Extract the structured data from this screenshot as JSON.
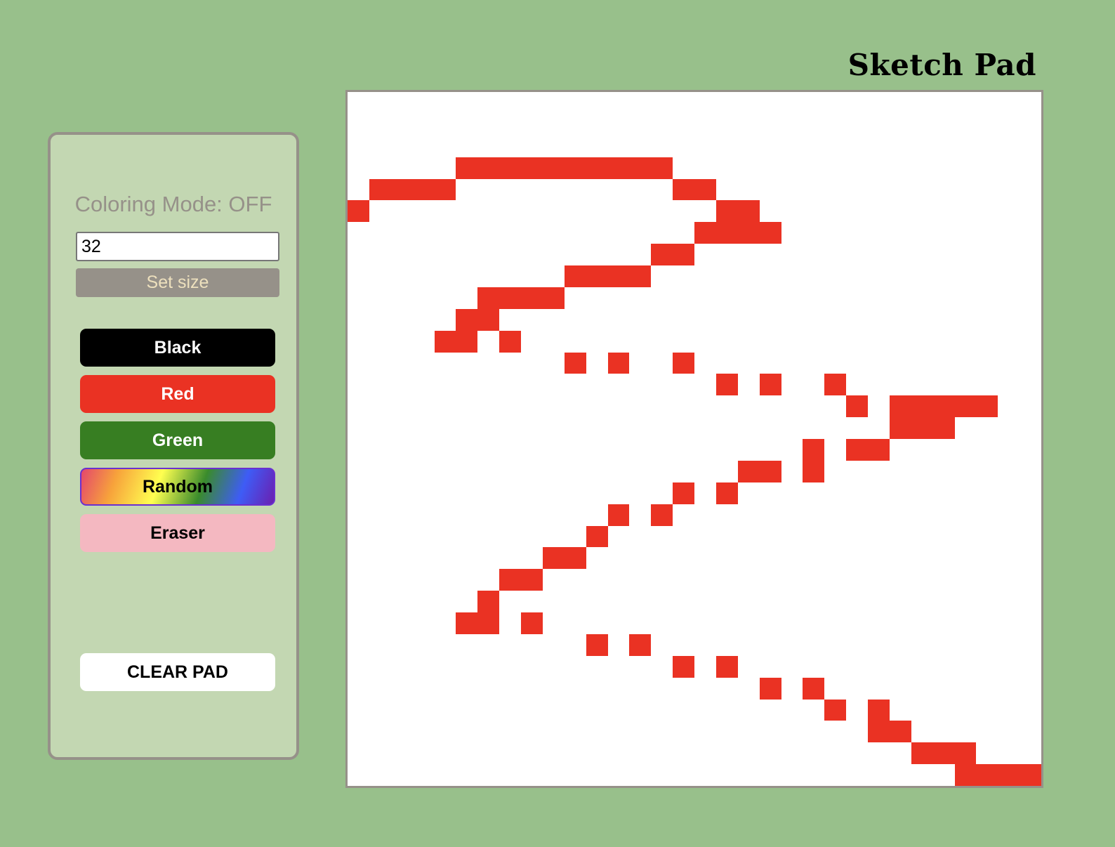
{
  "header": {
    "title": "Sketch Pad"
  },
  "controls": {
    "coloring_mode": "Coloring Mode: OFF",
    "size_input_value": "32",
    "set_size_label": "Set size",
    "buttons": {
      "black": "Black",
      "red": "Red",
      "green": "Green",
      "random": "Random",
      "eraser": "Eraser"
    },
    "clear_label": "CLEAR PAD"
  },
  "colors": {
    "background": "#98c08b",
    "panel": "#c3d7b2",
    "frame": "#969189",
    "black": "#000000",
    "red": "#ea3223",
    "green": "#377e22",
    "eraser": "#f4b8c1",
    "pad": "#ffffff"
  },
  "pad": {
    "grid_size": 32,
    "paint_color": "#ea3223",
    "filled_cells": [
      [
        3,
        5
      ],
      [
        3,
        6
      ],
      [
        3,
        7
      ],
      [
        3,
        8
      ],
      [
        3,
        9
      ],
      [
        3,
        10
      ],
      [
        3,
        11
      ],
      [
        3,
        12
      ],
      [
        3,
        13
      ],
      [
        3,
        14
      ],
      [
        4,
        1
      ],
      [
        4,
        2
      ],
      [
        4,
        3
      ],
      [
        4,
        4
      ],
      [
        4,
        15
      ],
      [
        4,
        16
      ],
      [
        5,
        0
      ],
      [
        5,
        17
      ],
      [
        5,
        18
      ],
      [
        6,
        16
      ],
      [
        6,
        17
      ],
      [
        6,
        18
      ],
      [
        6,
        19
      ],
      [
        7,
        14
      ],
      [
        7,
        15
      ],
      [
        8,
        10
      ],
      [
        8,
        11
      ],
      [
        8,
        12
      ],
      [
        8,
        13
      ],
      [
        9,
        6
      ],
      [
        9,
        7
      ],
      [
        9,
        8
      ],
      [
        9,
        9
      ],
      [
        10,
        5
      ],
      [
        10,
        6
      ],
      [
        11,
        4
      ],
      [
        11,
        5
      ],
      [
        11,
        7
      ],
      [
        12,
        10
      ],
      [
        12,
        12
      ],
      [
        12,
        15
      ],
      [
        13,
        17
      ],
      [
        13,
        19
      ],
      [
        13,
        22
      ],
      [
        14,
        23
      ],
      [
        14,
        25
      ],
      [
        14,
        26
      ],
      [
        14,
        27
      ],
      [
        14,
        28
      ],
      [
        14,
        29
      ],
      [
        15,
        25
      ],
      [
        15,
        26
      ],
      [
        15,
        27
      ],
      [
        16,
        21
      ],
      [
        16,
        23
      ],
      [
        16,
        24
      ],
      [
        17,
        18
      ],
      [
        17,
        19
      ],
      [
        17,
        21
      ],
      [
        18,
        15
      ],
      [
        18,
        17
      ],
      [
        19,
        12
      ],
      [
        19,
        14
      ],
      [
        20,
        11
      ],
      [
        21,
        9
      ],
      [
        21,
        10
      ],
      [
        22,
        7
      ],
      [
        22,
        8
      ],
      [
        23,
        6
      ],
      [
        24,
        5
      ],
      [
        24,
        6
      ],
      [
        24,
        8
      ],
      [
        25,
        11
      ],
      [
        25,
        13
      ],
      [
        26,
        15
      ],
      [
        26,
        17
      ],
      [
        27,
        19
      ],
      [
        27,
        21
      ],
      [
        28,
        22
      ],
      [
        28,
        24
      ],
      [
        29,
        24
      ],
      [
        29,
        25
      ],
      [
        30,
        26
      ],
      [
        30,
        27
      ],
      [
        30,
        28
      ],
      [
        31,
        28
      ],
      [
        31,
        29
      ],
      [
        31,
        30
      ],
      [
        31,
        31
      ]
    ]
  }
}
